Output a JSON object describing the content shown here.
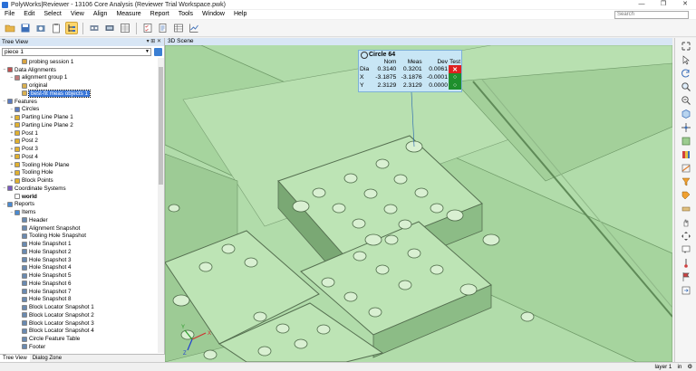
{
  "window": {
    "title": "PolyWorks|Reviewer - 13106 Core Analysis (Reviewer Trial Workspace.pwk)",
    "controls": [
      "—",
      "❐",
      "✕"
    ]
  },
  "menu": {
    "items": [
      "File",
      "Edit",
      "Select",
      "View",
      "Align",
      "Measure",
      "Report",
      "Tools",
      "Window",
      "Help"
    ],
    "search_placeholder": "Search"
  },
  "tree_panel": {
    "title": "Tree View",
    "header_buttons": "▾ ⊞ ✕",
    "piece": "piece 1",
    "items": [
      {
        "label": "probing session 1",
        "indent": 2,
        "expander": "",
        "icon_color": "#d9a441"
      },
      {
        "label": "Data Alignments",
        "indent": 0,
        "expander": "−",
        "icon_color": "#c05050"
      },
      {
        "label": "alignment group 1",
        "indent": 1,
        "expander": "−",
        "icon_color": "#c07a7a"
      },
      {
        "label": "original",
        "indent": 2,
        "expander": "",
        "icon_color": "#d9b050"
      },
      {
        "label": "best-fit meas objects 1",
        "indent": 2,
        "expander": "",
        "icon_color": "#d9b050",
        "selected": true
      },
      {
        "label": "Features",
        "indent": 0,
        "expander": "−",
        "icon_color": "#5a7bc0"
      },
      {
        "label": "Circles",
        "indent": 1,
        "expander": "−",
        "icon_color": "#5a7bc0"
      },
      {
        "label": "Parting Line Plane 1",
        "indent": 1,
        "expander": "+",
        "icon_color": "#e0b030"
      },
      {
        "label": "Parting Line Plane 2",
        "indent": 1,
        "expander": "+",
        "icon_color": "#e0b030"
      },
      {
        "label": "Post 1",
        "indent": 1,
        "expander": "+",
        "icon_color": "#e0b030"
      },
      {
        "label": "Post 2",
        "indent": 1,
        "expander": "+",
        "icon_color": "#e0b030"
      },
      {
        "label": "Post 3",
        "indent": 1,
        "expander": "+",
        "icon_color": "#e0b030"
      },
      {
        "label": "Post 4",
        "indent": 1,
        "expander": "+",
        "icon_color": "#e0b030"
      },
      {
        "label": "Tooling Hole Plane",
        "indent": 1,
        "expander": "+",
        "icon_color": "#e0b030"
      },
      {
        "label": "Tooling Hole",
        "indent": 1,
        "expander": "+",
        "icon_color": "#e0b030"
      },
      {
        "label": "Block Points",
        "indent": 1,
        "expander": "+",
        "icon_color": "#e0b030"
      },
      {
        "label": "Coordinate Systems",
        "indent": 0,
        "expander": "−",
        "icon_color": "#7a5ac0"
      },
      {
        "label": "world",
        "indent": 1,
        "expander": "",
        "icon_color": "#ffffff",
        "bold": true
      },
      {
        "label": "Reports",
        "indent": 0,
        "expander": "−",
        "icon_color": "#4a8ad0"
      },
      {
        "label": "Items",
        "indent": 1,
        "expander": "−",
        "icon_color": "#4a8ad0"
      },
      {
        "label": "Header",
        "indent": 2,
        "expander": "",
        "icon_color": "#6a8ab0"
      },
      {
        "label": "Alignment Snapshot",
        "indent": 2,
        "expander": "",
        "icon_color": "#6a8ab0"
      },
      {
        "label": "Tooling Hole Snapshot",
        "indent": 2,
        "expander": "",
        "icon_color": "#6a8ab0"
      },
      {
        "label": "Hole Snapshot 1",
        "indent": 2,
        "expander": "",
        "icon_color": "#6a8ab0"
      },
      {
        "label": "Hole Snapshot 2",
        "indent": 2,
        "expander": "",
        "icon_color": "#6a8ab0"
      },
      {
        "label": "Hole Snapshot 3",
        "indent": 2,
        "expander": "",
        "icon_color": "#6a8ab0"
      },
      {
        "label": "Hole Snapshot 4",
        "indent": 2,
        "expander": "",
        "icon_color": "#6a8ab0"
      },
      {
        "label": "Hole Snapshot 5",
        "indent": 2,
        "expander": "",
        "icon_color": "#6a8ab0"
      },
      {
        "label": "Hole Snapshot 6",
        "indent": 2,
        "expander": "",
        "icon_color": "#6a8ab0"
      },
      {
        "label": "Hole Snapshot 7",
        "indent": 2,
        "expander": "",
        "icon_color": "#6a8ab0"
      },
      {
        "label": "Hole Snapshot 8",
        "indent": 2,
        "expander": "",
        "icon_color": "#6a8ab0"
      },
      {
        "label": "Block Locator Snapshot 1",
        "indent": 2,
        "expander": "",
        "icon_color": "#6a8ab0"
      },
      {
        "label": "Block Locator Snapshot 2",
        "indent": 2,
        "expander": "",
        "icon_color": "#6a8ab0"
      },
      {
        "label": "Block Locator Snapshot 3",
        "indent": 2,
        "expander": "",
        "icon_color": "#6a8ab0"
      },
      {
        "label": "Block Locator Snapshot 4",
        "indent": 2,
        "expander": "",
        "icon_color": "#6a8ab0"
      },
      {
        "label": "Circle Feature Table",
        "indent": 2,
        "expander": "",
        "icon_color": "#6a8ab0"
      },
      {
        "label": "Footer",
        "indent": 2,
        "expander": "",
        "icon_color": "#6a8ab0"
      }
    ],
    "tabs": [
      "Tree View",
      "Dialog Zone"
    ]
  },
  "scene": {
    "title": "3D Scene",
    "background": "#b1dcaa",
    "annotation": {
      "title": "Circle 64",
      "columns": [
        "Nom",
        "Meas",
        "Dev",
        "Test"
      ],
      "rows": [
        {
          "label": "Dia",
          "nom": "0.3140",
          "meas": "0.3201",
          "dev": "0.0061",
          "test": "✕",
          "status": "fail"
        },
        {
          "label": "X",
          "nom": "-3.1875",
          "meas": "-3.1876",
          "dev": "-0.0001",
          "test": "○",
          "status": "pass"
        },
        {
          "label": "Y",
          "nom": "2.3129",
          "meas": "2.3129",
          "dev": "0.0000",
          "test": "○",
          "status": "pass"
        }
      ]
    },
    "axes": {
      "x": "X",
      "y": "Y",
      "z": "Z"
    }
  },
  "statusbar": {
    "layer": "layer 1",
    "units": "in",
    "extra": "⚙"
  },
  "colors": {
    "accent": "#3a77d9",
    "fail": "#e02020",
    "pass": "#1e8f2d",
    "panel_header": "#d8e6f5"
  }
}
